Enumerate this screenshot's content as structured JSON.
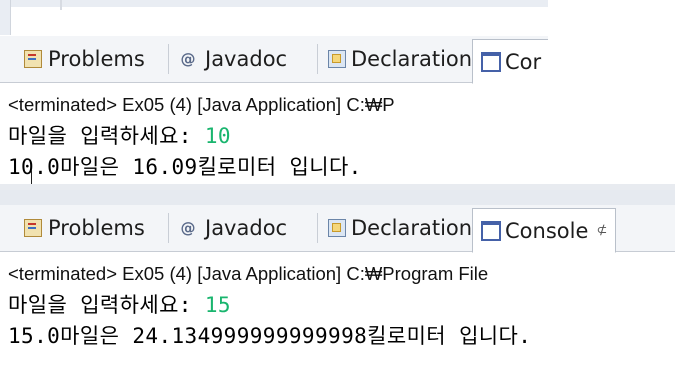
{
  "colors": {
    "input_text": "#19b56e",
    "tabbar_bg": "#f3f5f8",
    "border": "#c7ccd4"
  },
  "panel1": {
    "tabs": [
      {
        "label": "Problems",
        "icon": "problems-icon"
      },
      {
        "label": "Javadoc",
        "icon": "javadoc-icon"
      },
      {
        "label": "Declaration",
        "icon": "declaration-icon"
      },
      {
        "label": "Cor",
        "icon": "console-icon"
      }
    ],
    "terminated": "<terminated> Ex05 (4) [Java Application] C:₩P",
    "prompt": "마일을 입력하세요: ",
    "input_value": "10",
    "result": "10.0마일은 16.09킬로미터 입니다."
  },
  "panel2": {
    "tabs": [
      {
        "label": "Problems",
        "icon": "problems-icon"
      },
      {
        "label": "Javadoc",
        "icon": "javadoc-icon"
      },
      {
        "label": "Declaration",
        "icon": "declaration-icon"
      },
      {
        "label": "Console",
        "icon": "console-icon",
        "close": "⊄"
      }
    ],
    "terminated": "<terminated> Ex05 (4) [Java Application] C:₩Program File",
    "prompt": "마일을 입력하세요: ",
    "input_value": "15",
    "result": "15.0마일은 24.134999999999998킬로미터 입니다."
  }
}
